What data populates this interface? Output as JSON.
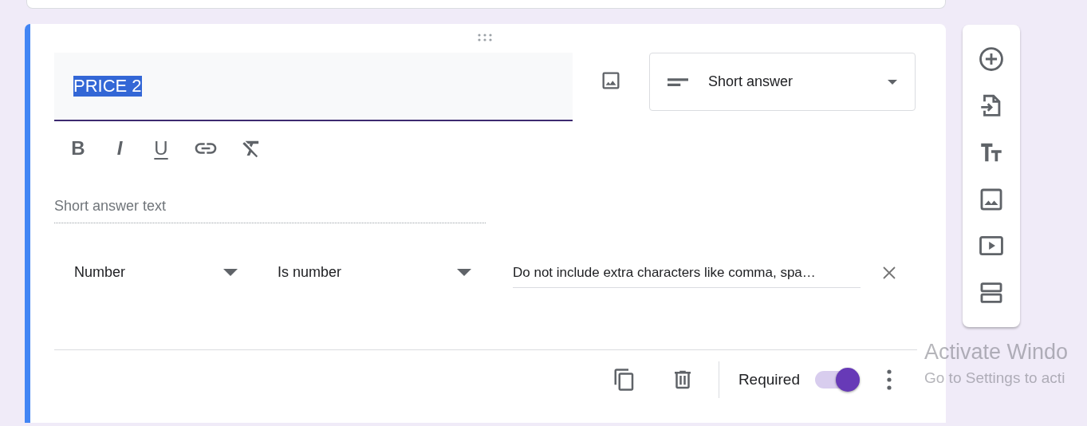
{
  "question": {
    "title": {
      "text": "PRICE 2",
      "selected": true
    },
    "answer_type": {
      "value": "Short answer"
    },
    "format_buttons": [
      {
        "label": "B",
        "kind": "bold"
      },
      {
        "label": "I",
        "kind": "italic"
      },
      {
        "label": "U",
        "kind": "underline"
      }
    ],
    "answer": {
      "placeholder": "Short answer text"
    },
    "validation": {
      "type": "Number",
      "condition": "Is number",
      "error_text": "Do not include extra characters like comma, spa…"
    },
    "required": {
      "label": "Required",
      "on": true
    }
  },
  "os_notice": {
    "title": "Activate Windo",
    "text": "Go to Settings to acti"
  }
}
